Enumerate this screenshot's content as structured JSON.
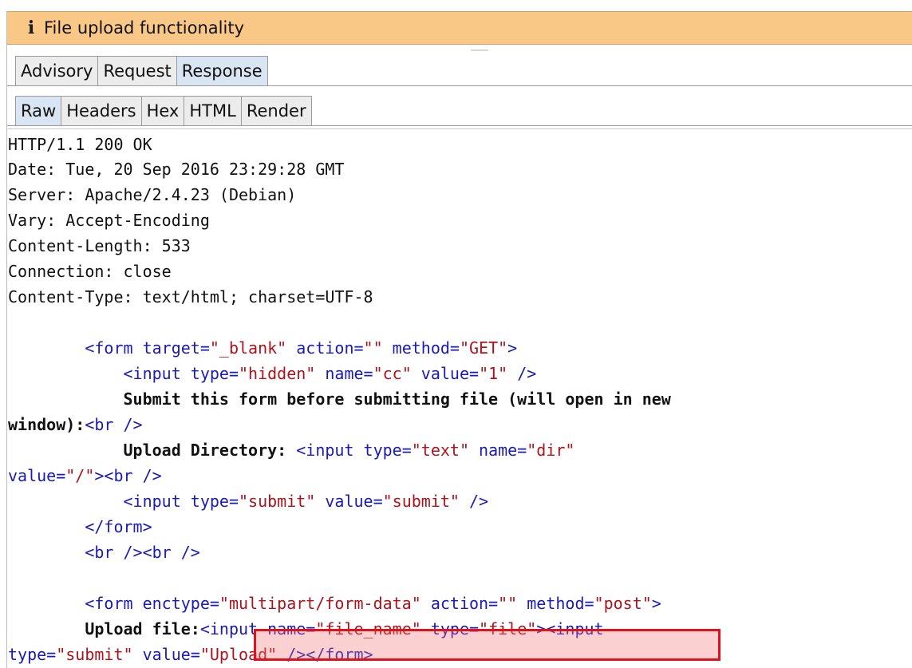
{
  "info_bar": {
    "icon": "info-icon",
    "text": "File upload functionality"
  },
  "main_tabs": [
    {
      "label": "Advisory",
      "active": false
    },
    {
      "label": "Request",
      "active": false
    },
    {
      "label": "Response",
      "active": true
    }
  ],
  "view_tabs": [
    {
      "label": "Raw",
      "active": true
    },
    {
      "label": "Headers",
      "active": false
    },
    {
      "label": "Hex",
      "active": false
    },
    {
      "label": "HTML",
      "active": false
    },
    {
      "label": "Render",
      "active": false
    }
  ],
  "colors": {
    "info_bar": "#f9c886",
    "active_tab": "#d9e5f2",
    "tag": "#1a1ab8",
    "string": "#b0121b",
    "highlight_border": "#e0121b"
  },
  "response": {
    "headers": [
      "HTTP/1.1 200 OK",
      "Date: Tue, 20 Sep 2016 23:29:28 GMT",
      "Server: Apache/2.4.23 (Debian)",
      "Vary: Accept-Encoding",
      "Content-Length: 533",
      "Connection: close",
      "Content-Type: text/html; charset=UTF-8"
    ],
    "body": [
      {
        "segs": [
          {
            "t": ""
          }
        ]
      },
      {
        "segs": [
          {
            "t": "        "
          },
          {
            "t": "<form ",
            "c": "tag"
          },
          {
            "t": "target=",
            "c": "attr"
          },
          {
            "t": "\"_blank\"",
            "c": "str"
          },
          {
            "t": " action=",
            "c": "attr"
          },
          {
            "t": "\"\"",
            "c": "str"
          },
          {
            "t": " method=",
            "c": "attr"
          },
          {
            "t": "\"GET\"",
            "c": "str"
          },
          {
            "t": ">",
            "c": "tag"
          }
        ]
      },
      {
        "segs": [
          {
            "t": "            "
          },
          {
            "t": "<input ",
            "c": "tag"
          },
          {
            "t": "type=",
            "c": "attr"
          },
          {
            "t": "\"hidden\"",
            "c": "str"
          },
          {
            "t": " name=",
            "c": "attr"
          },
          {
            "t": "\"cc\"",
            "c": "str"
          },
          {
            "t": " value=",
            "c": "attr"
          },
          {
            "t": "\"1\"",
            "c": "str"
          },
          {
            "t": " />",
            "c": "tag"
          }
        ]
      },
      {
        "segs": [
          {
            "t": "            "
          },
          {
            "t": "Submit this form before submitting file (will open in new",
            "c": "bold"
          }
        ]
      },
      {
        "segs": [
          {
            "t": "window):",
            "c": "bold"
          },
          {
            "t": "<br />",
            "c": "tag"
          }
        ]
      },
      {
        "segs": [
          {
            "t": "            "
          },
          {
            "t": "Upload Directory:",
            "c": "bold"
          },
          {
            "t": " "
          },
          {
            "t": "<input ",
            "c": "tag"
          },
          {
            "t": "type=",
            "c": "attr"
          },
          {
            "t": "\"text\"",
            "c": "str"
          },
          {
            "t": " name=",
            "c": "attr"
          },
          {
            "t": "\"dir\"",
            "c": "str"
          }
        ]
      },
      {
        "segs": [
          {
            "t": "value=",
            "c": "attr"
          },
          {
            "t": "\"/\"",
            "c": "str"
          },
          {
            "t": "><br />",
            "c": "tag"
          }
        ]
      },
      {
        "segs": [
          {
            "t": "            "
          },
          {
            "t": "<input ",
            "c": "tag"
          },
          {
            "t": "type=",
            "c": "attr"
          },
          {
            "t": "\"submit\"",
            "c": "str"
          },
          {
            "t": " value=",
            "c": "attr"
          },
          {
            "t": "\"submit\"",
            "c": "str"
          },
          {
            "t": " />",
            "c": "tag"
          }
        ]
      },
      {
        "segs": [
          {
            "t": "        "
          },
          {
            "t": "</form>",
            "c": "tag"
          }
        ]
      },
      {
        "segs": [
          {
            "t": "        "
          },
          {
            "t": "<br /><br />",
            "c": "tag"
          }
        ]
      },
      {
        "segs": [
          {
            "t": ""
          }
        ]
      },
      {
        "segs": [
          {
            "t": "        "
          },
          {
            "t": "<form ",
            "c": "tag"
          },
          {
            "t": "enctype=",
            "c": "attr"
          },
          {
            "t": "\"multipart/form-data\"",
            "c": "str"
          },
          {
            "t": " action=",
            "c": "attr"
          },
          {
            "t": "\"\"",
            "c": "str"
          },
          {
            "t": " method=",
            "c": "attr"
          },
          {
            "t": "\"post\"",
            "c": "str"
          },
          {
            "t": ">",
            "c": "tag"
          }
        ]
      },
      {
        "segs": [
          {
            "t": "        "
          },
          {
            "t": "Upload file:",
            "c": "bold"
          },
          {
            "t": "<input ",
            "c": "tag"
          },
          {
            "t": "name=",
            "c": "attr"
          },
          {
            "t": "\"file_name\"",
            "c": "str"
          },
          {
            "t": " type=",
            "c": "attr"
          },
          {
            "t": "\"file\"",
            "c": "str"
          },
          {
            "t": "><input",
            "c": "tag"
          }
        ]
      },
      {
        "segs": [
          {
            "t": "type=",
            "c": "attr"
          },
          {
            "t": "\"submit\"",
            "c": "str"
          },
          {
            "t": " value=",
            "c": "attr"
          },
          {
            "t": "\"Upload\"",
            "c": "str"
          },
          {
            "t": " /></form>",
            "c": "tag"
          }
        ]
      }
    ]
  }
}
